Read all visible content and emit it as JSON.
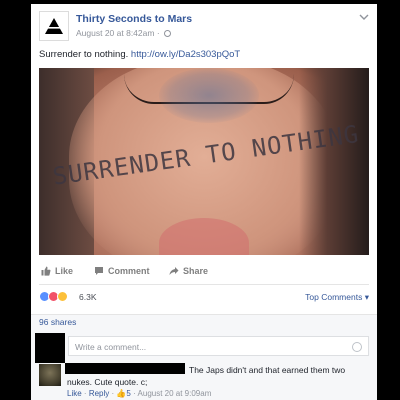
{
  "post": {
    "page_name": "Thirty Seconds to Mars",
    "timestamp": "August 20 at 8:42am",
    "separator": "·",
    "text": "Surrender to nothing.",
    "link": "http://ow.ly/Da2s303pQoT",
    "photo_text": "SURRENDER TO NOTHING"
  },
  "actions": {
    "like": "Like",
    "comment": "Comment",
    "share": "Share"
  },
  "reactions": {
    "count": "6.3K",
    "top_comments": "Top Comments",
    "shares": "96 shares",
    "colors": {
      "like": "#5890ff",
      "love": "#f25268",
      "wow": "#fcc03a"
    }
  },
  "comment_box": {
    "placeholder": "Write a comment..."
  },
  "comment": {
    "text": "The Japs didn't and that earned them two nukes. Cute quote. c;",
    "like": "Like",
    "reply": "Reply",
    "likes": "5",
    "timestamp": "August 20 at 9:09am",
    "dot": "·"
  }
}
